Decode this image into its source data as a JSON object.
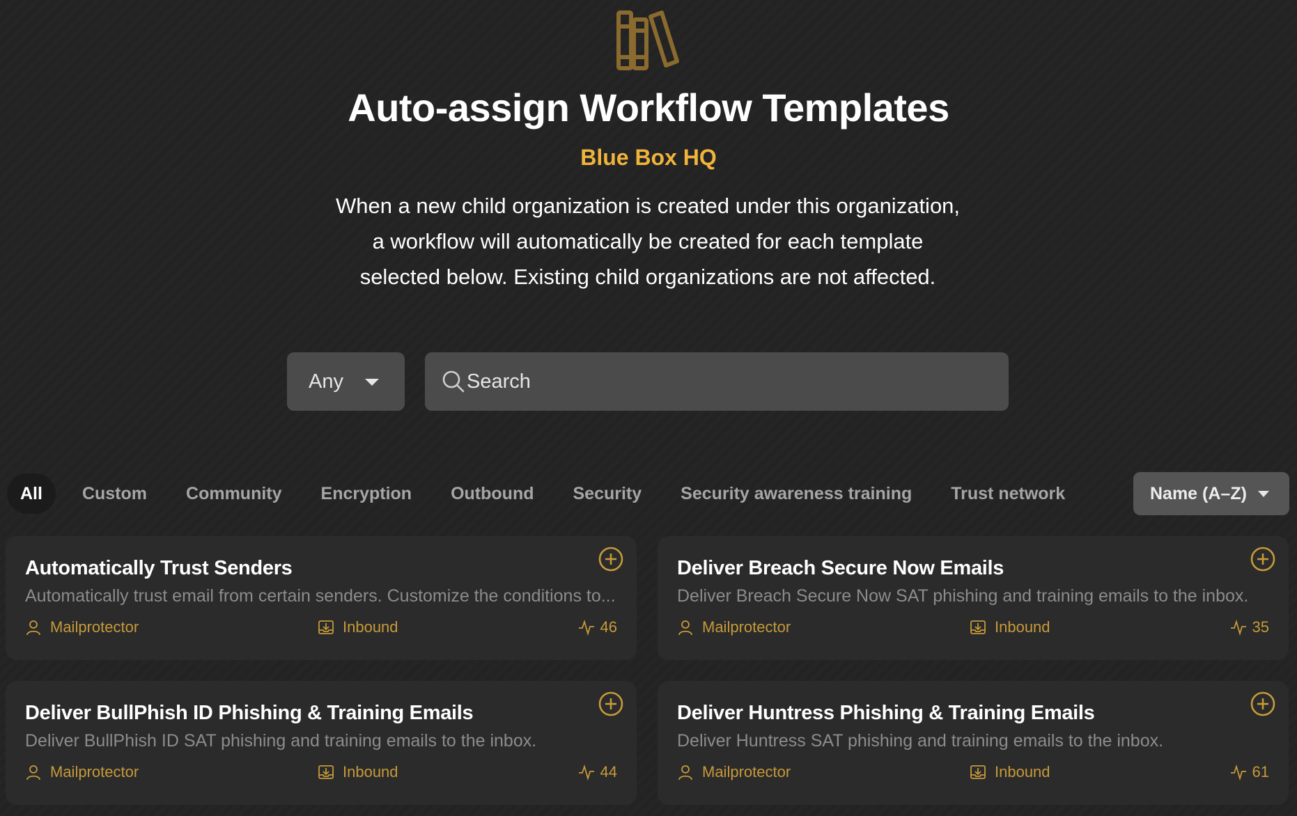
{
  "header": {
    "icon": "books-icon",
    "title": "Auto-assign Workflow Templates",
    "organization": "Blue Box HQ",
    "description_lines": [
      "When a new child organization is created under this organization,",
      "a workflow will automatically be created for each template",
      "selected below. Existing child organizations are not affected."
    ]
  },
  "filters": {
    "select_value": "Any",
    "search_placeholder": "Search",
    "search_value": ""
  },
  "tabs": [
    {
      "label": "All",
      "active": true
    },
    {
      "label": "Custom",
      "active": false
    },
    {
      "label": "Community",
      "active": false
    },
    {
      "label": "Encryption",
      "active": false
    },
    {
      "label": "Outbound",
      "active": false
    },
    {
      "label": "Security",
      "active": false
    },
    {
      "label": "Security awareness training",
      "active": false
    },
    {
      "label": "Trust network",
      "active": false
    }
  ],
  "sort": {
    "label": "Name (A–Z)"
  },
  "cards": [
    {
      "title": "Automatically Trust Senders",
      "description": "Automatically trust email from certain senders. Customize the conditions to...",
      "author": "Mailprotector",
      "direction": "Inbound",
      "count": "46"
    },
    {
      "title": "Deliver Breach Secure Now Emails",
      "description": "Deliver Breach Secure Now SAT phishing and training emails to the inbox.",
      "author": "Mailprotector",
      "direction": "Inbound",
      "count": "35"
    },
    {
      "title": "Deliver BullPhish ID Phishing & Training Emails",
      "description": "Deliver BullPhish ID SAT phishing and training emails to the inbox.",
      "author": "Mailprotector",
      "direction": "Inbound",
      "count": "44"
    },
    {
      "title": "Deliver Huntress Phishing & Training Emails",
      "description": "Deliver Huntress SAT phishing and training emails to the inbox.",
      "author": "Mailprotector",
      "direction": "Inbound",
      "count": "61"
    }
  ],
  "colors": {
    "accent": "#f0b43c",
    "meta": "#c69a3a",
    "background": "#242424",
    "card": "#2b2b2b",
    "input": "#4b4b4b"
  }
}
